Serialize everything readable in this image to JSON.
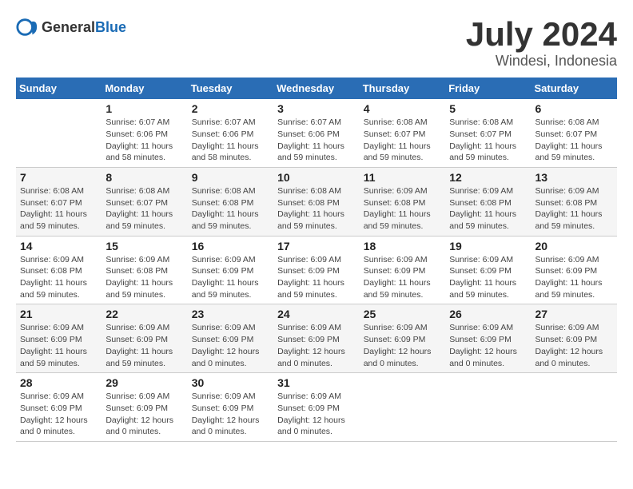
{
  "header": {
    "logo_general": "General",
    "logo_blue": "Blue",
    "month_year": "July 2024",
    "location": "Windesi, Indonesia"
  },
  "weekdays": [
    "Sunday",
    "Monday",
    "Tuesday",
    "Wednesday",
    "Thursday",
    "Friday",
    "Saturday"
  ],
  "weeks": [
    [
      null,
      {
        "day": "1",
        "sunrise": "6:07 AM",
        "sunset": "6:06 PM",
        "daylight": "11 hours and 58 minutes."
      },
      {
        "day": "2",
        "sunrise": "6:07 AM",
        "sunset": "6:06 PM",
        "daylight": "11 hours and 58 minutes."
      },
      {
        "day": "3",
        "sunrise": "6:07 AM",
        "sunset": "6:06 PM",
        "daylight": "11 hours and 59 minutes."
      },
      {
        "day": "4",
        "sunrise": "6:08 AM",
        "sunset": "6:07 PM",
        "daylight": "11 hours and 59 minutes."
      },
      {
        "day": "5",
        "sunrise": "6:08 AM",
        "sunset": "6:07 PM",
        "daylight": "11 hours and 59 minutes."
      },
      {
        "day": "6",
        "sunrise": "6:08 AM",
        "sunset": "6:07 PM",
        "daylight": "11 hours and 59 minutes."
      }
    ],
    [
      {
        "day": "7",
        "sunrise": "6:08 AM",
        "sunset": "6:07 PM",
        "daylight": "11 hours and 59 minutes."
      },
      {
        "day": "8",
        "sunrise": "6:08 AM",
        "sunset": "6:07 PM",
        "daylight": "11 hours and 59 minutes."
      },
      {
        "day": "9",
        "sunrise": "6:08 AM",
        "sunset": "6:08 PM",
        "daylight": "11 hours and 59 minutes."
      },
      {
        "day": "10",
        "sunrise": "6:08 AM",
        "sunset": "6:08 PM",
        "daylight": "11 hours and 59 minutes."
      },
      {
        "day": "11",
        "sunrise": "6:09 AM",
        "sunset": "6:08 PM",
        "daylight": "11 hours and 59 minutes."
      },
      {
        "day": "12",
        "sunrise": "6:09 AM",
        "sunset": "6:08 PM",
        "daylight": "11 hours and 59 minutes."
      },
      {
        "day": "13",
        "sunrise": "6:09 AM",
        "sunset": "6:08 PM",
        "daylight": "11 hours and 59 minutes."
      }
    ],
    [
      {
        "day": "14",
        "sunrise": "6:09 AM",
        "sunset": "6:08 PM",
        "daylight": "11 hours and 59 minutes."
      },
      {
        "day": "15",
        "sunrise": "6:09 AM",
        "sunset": "6:08 PM",
        "daylight": "11 hours and 59 minutes."
      },
      {
        "day": "16",
        "sunrise": "6:09 AM",
        "sunset": "6:09 PM",
        "daylight": "11 hours and 59 minutes."
      },
      {
        "day": "17",
        "sunrise": "6:09 AM",
        "sunset": "6:09 PM",
        "daylight": "11 hours and 59 minutes."
      },
      {
        "day": "18",
        "sunrise": "6:09 AM",
        "sunset": "6:09 PM",
        "daylight": "11 hours and 59 minutes."
      },
      {
        "day": "19",
        "sunrise": "6:09 AM",
        "sunset": "6:09 PM",
        "daylight": "11 hours and 59 minutes."
      },
      {
        "day": "20",
        "sunrise": "6:09 AM",
        "sunset": "6:09 PM",
        "daylight": "11 hours and 59 minutes."
      }
    ],
    [
      {
        "day": "21",
        "sunrise": "6:09 AM",
        "sunset": "6:09 PM",
        "daylight": "11 hours and 59 minutes."
      },
      {
        "day": "22",
        "sunrise": "6:09 AM",
        "sunset": "6:09 PM",
        "daylight": "11 hours and 59 minutes."
      },
      {
        "day": "23",
        "sunrise": "6:09 AM",
        "sunset": "6:09 PM",
        "daylight": "12 hours and 0 minutes."
      },
      {
        "day": "24",
        "sunrise": "6:09 AM",
        "sunset": "6:09 PM",
        "daylight": "12 hours and 0 minutes."
      },
      {
        "day": "25",
        "sunrise": "6:09 AM",
        "sunset": "6:09 PM",
        "daylight": "12 hours and 0 minutes."
      },
      {
        "day": "26",
        "sunrise": "6:09 AM",
        "sunset": "6:09 PM",
        "daylight": "12 hours and 0 minutes."
      },
      {
        "day": "27",
        "sunrise": "6:09 AM",
        "sunset": "6:09 PM",
        "daylight": "12 hours and 0 minutes."
      }
    ],
    [
      {
        "day": "28",
        "sunrise": "6:09 AM",
        "sunset": "6:09 PM",
        "daylight": "12 hours and 0 minutes."
      },
      {
        "day": "29",
        "sunrise": "6:09 AM",
        "sunset": "6:09 PM",
        "daylight": "12 hours and 0 minutes."
      },
      {
        "day": "30",
        "sunrise": "6:09 AM",
        "sunset": "6:09 PM",
        "daylight": "12 hours and 0 minutes."
      },
      {
        "day": "31",
        "sunrise": "6:09 AM",
        "sunset": "6:09 PM",
        "daylight": "12 hours and 0 minutes."
      },
      null,
      null,
      null
    ]
  ]
}
